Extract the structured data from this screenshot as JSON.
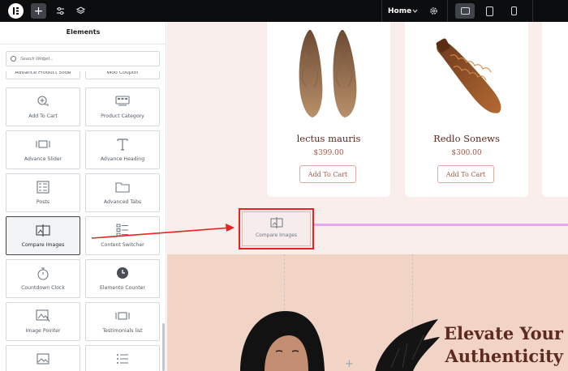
{
  "topbar": {
    "page_name": "Home",
    "icons": [
      "elementor-logo-icon",
      "plus-icon",
      "sliders-icon",
      "layers-icon",
      "chevron-down-icon",
      "gear-icon",
      "desktop-icon",
      "tablet-icon",
      "mobile-icon"
    ]
  },
  "sidebar": {
    "title": "Elements",
    "search_placeholder": "Search Widget...",
    "widgets": [
      {
        "label": "Advance Product Slide",
        "icon": "slider-icon"
      },
      {
        "label": "Woo Coupon",
        "icon": "coupon-icon"
      },
      {
        "label": "Add To Cart",
        "icon": "add-to-cart-icon"
      },
      {
        "label": "Product Category",
        "icon": "product-category-icon"
      },
      {
        "label": "Advance Slider",
        "icon": "advance-slider-icon"
      },
      {
        "label": "Advance Heading",
        "icon": "heading-icon"
      },
      {
        "label": "Posts",
        "icon": "posts-icon"
      },
      {
        "label": "Advanced Tabs",
        "icon": "tabs-icon"
      },
      {
        "label": "Compare Images",
        "icon": "compare-images-icon"
      },
      {
        "label": "Content Switcher",
        "icon": "content-switcher-icon"
      },
      {
        "label": "Countdown Clock",
        "icon": "stopwatch-icon"
      },
      {
        "label": "Elemento Counter",
        "icon": "counter-icon"
      },
      {
        "label": "Image Pointer",
        "icon": "image-pointer-icon"
      },
      {
        "label": "Testimonials list",
        "icon": "testimonials-icon"
      },
      {
        "label": "",
        "icon": "image-icon"
      },
      {
        "label": "",
        "icon": "list-icon"
      }
    ]
  },
  "canvas": {
    "products": [
      {
        "title": "lectus mauris",
        "price": "$399.00",
        "button": "Add To Cart"
      },
      {
        "title": "Redlo Sonews",
        "price": "$300.00",
        "button": "Add To Cart"
      }
    ],
    "drop_area_label": "Compare Images",
    "hero_title_line1": "Elevate Your",
    "hero_title_line2": "Authenticity"
  },
  "colors": {
    "accent_red": "#e52421",
    "drop_line": "#e6a7f0",
    "brand_brown": "#5c2a1f",
    "canvas_bg": "#f9eeec",
    "hero_bg": "#f2d4c7"
  }
}
